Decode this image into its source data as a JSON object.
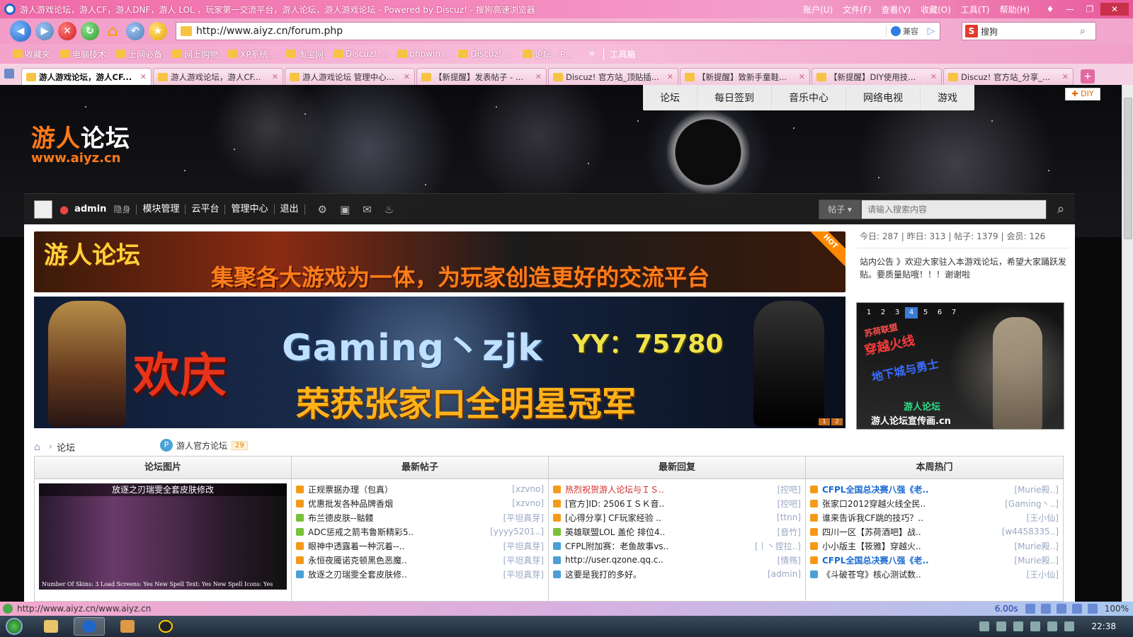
{
  "window": {
    "title": "游人游戏论坛，游人CF，游人DNF，游人 LOL ，玩家第一交流平台，游人论坛，游人游戏论坛 - Powered by Discuz! - 搜狗高速浏览器",
    "menus": [
      "账户(U)",
      "文件(F)",
      "查看(V)",
      "收藏(O)",
      "工具(T)",
      "帮助(H)"
    ]
  },
  "addressbar": {
    "url": "http://www.aiyz.cn/forum.php",
    "compat_label": "兼容",
    "search_engine": "搜狗"
  },
  "favorites": {
    "items": [
      "收藏夹",
      "电脑技术",
      "上网必备",
      "网上购物",
      "XP系统...",
      "淘宝网",
      "Discuz! ...",
      "phpwin...",
      "Discuz! ...",
      "论坛 - P..."
    ],
    "more": "»",
    "toolbox": "工具箱"
  },
  "tabs": [
    {
      "label": "游人游戏论坛，游人CF...",
      "active": true
    },
    {
      "label": "游人游戏论坛，游人CF...",
      "active": false
    },
    {
      "label": "游人游戏论坛 管理中心...",
      "active": false
    },
    {
      "label": "【新提醒】发表帖子 - ...",
      "active": false
    },
    {
      "label": "Discuz! 官方站_顶贴插...",
      "active": false
    },
    {
      "label": "【新提醒】致新手童鞋...",
      "active": false
    },
    {
      "label": "【新提醒】DIY使用技...",
      "active": false
    },
    {
      "label": "Discuz! 官方站_分享_...",
      "active": false
    }
  ],
  "site": {
    "logo_cn_a": "游人",
    "logo_cn_b": "论坛",
    "logo_url": "www.aiyz.cn",
    "nav": [
      "论坛",
      "每日签到",
      "音乐中心",
      "网络电视",
      "游戏"
    ],
    "diy": "DIY"
  },
  "userbar": {
    "username": "admin",
    "invisible": "隐身",
    "links": [
      "模块管理",
      "云平台",
      "管理中心",
      "退出"
    ],
    "search_type": "帖子",
    "search_placeholder": "请输入搜索内容"
  },
  "banner1": {
    "title": "游人论坛",
    "slogan": "集聚各大游戏为一体，为玩家创造更好的交流平台",
    "hot": "HOT"
  },
  "banner2": {
    "celebrate": "欢庆",
    "name": "Gaming丶zjk",
    "yy": "YY：75780",
    "award": "荣获张家口全明星冠军",
    "pages": [
      "1",
      "2"
    ]
  },
  "stats": {
    "today": "今日: 287",
    "yesterday": "昨日: 313",
    "posts": "帖子: 1379",
    "members": "会员: 126",
    "notice": "站内公告 》欢迎大家驻入本游戏论坛，希望大家踊跃发贴。要质量贴哦！！！谢谢啦"
  },
  "promo": {
    "pages": [
      "1",
      "2",
      "3",
      "4",
      "5",
      "6",
      "7"
    ],
    "active_page": 3,
    "title": "穿越火线",
    "subtitle": "地下城与勇士",
    "tag": "苏荷联盟",
    "logo": "游人论坛",
    "caption": "游人论坛宣传画.cn"
  },
  "breadcrumb": {
    "current": "论坛",
    "forum": "游人官方论坛",
    "forum_count": "29"
  },
  "grid": {
    "headers": [
      "论坛图片",
      "最新帖子",
      "最新回复",
      "本周热门"
    ],
    "pic_caption": "放逐之刃瑞雯全套皮肤修改",
    "pic_text": "Number Of Skins: 3   Load Screens: Yes   New Spell Text: Yes   New Spell Icons: Yes",
    "new_posts": [
      {
        "title": "正规票据办理（包真）",
        "user": "[xzvno]"
      },
      {
        "title": "优惠批发各种品牌香烟",
        "user": "[xzvno]"
      },
      {
        "title": "布兰德皮肤--骷髅",
        "user": "[平坦真芽]"
      },
      {
        "title": "ADC惩戒之箭韦鲁斯精彩5..",
        "user": "[yyyy5201..]"
      },
      {
        "title": "眼神中透露着一种沉着--..",
        "user": "[平坦真芽]"
      },
      {
        "title": "永恒夜魇诺克顿黑色恶魔..",
        "user": "[平坦真芽]"
      },
      {
        "title": "放逐之刃瑞雯全套皮肤修..",
        "user": "[平坦真芽]"
      }
    ],
    "new_replies": [
      {
        "title": "热烈祝贺游人论坛与ＩＳ..",
        "user": "[控吧]",
        "style": "red"
      },
      {
        "title": "[官方]ID: 2506ＩＳＫ音..",
        "user": "[控吧]",
        "style": ""
      },
      {
        "title": "[心得分享] CF玩家经验 ..",
        "user": "[ttnn]",
        "style": ""
      },
      {
        "title": "英雄联盟LOL 盖伦 排位4..",
        "user": "[音竹]",
        "style": ""
      },
      {
        "title": "CFPL附加赛：老鱼故事vs..",
        "user": "[丨丶捏拉..]",
        "style": ""
      },
      {
        "title": "http://user.qzone.qq.c..",
        "user": "[情殇]",
        "style": ""
      },
      {
        "title": "这要是我打的多好。",
        "user": "[admin]",
        "style": ""
      }
    ],
    "hot_week": [
      {
        "title": "CFPL全国总决赛八强《老..",
        "user": "[Murie殿..]",
        "style": "blue-b"
      },
      {
        "title": "张家口2012穿越火线全民..",
        "user": "[Gaming丶..]",
        "style": ""
      },
      {
        "title": "谁来告诉我CF跳的技巧？..",
        "user": "[王小仙]",
        "style": ""
      },
      {
        "title": "四川一区【苏荷酒吧】战..",
        "user": "[w4458335..]",
        "style": ""
      },
      {
        "title": "小小版主【筱雅】穿越火..",
        "user": "[Murie殿..]",
        "style": ""
      },
      {
        "title": "CFPL全国总决赛八强《老..",
        "user": "[Murie殿..]",
        "style": "blue-b"
      },
      {
        "title": "《斗破苍穹》核心测试数..",
        "user": "[王小仙]",
        "style": ""
      }
    ]
  },
  "statusbar": {
    "url": "http://www.aiyz.cn/www.aiyz.cn",
    "time": "6.00s",
    "zoom": "100%"
  },
  "taskbar": {
    "clock": "22:38"
  }
}
